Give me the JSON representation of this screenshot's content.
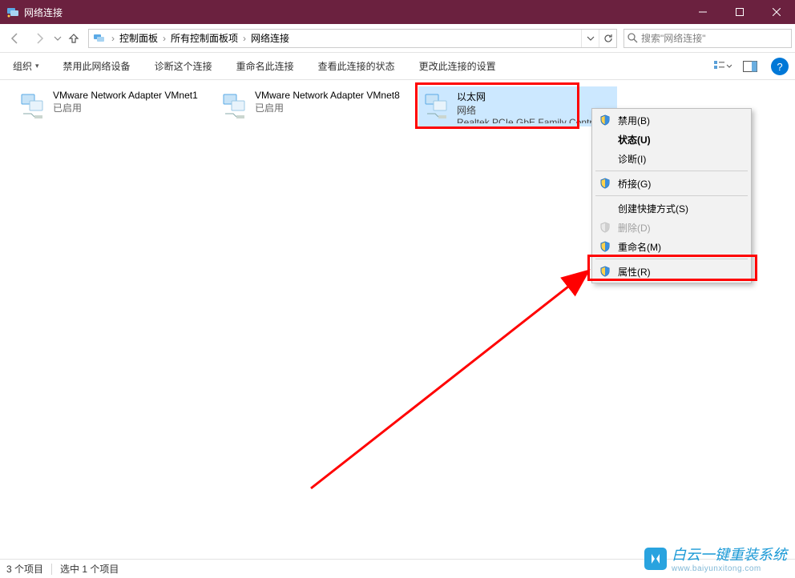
{
  "window": {
    "title": "网络连接"
  },
  "breadcrumbs": {
    "root": "控制面板",
    "mid": "所有控制面板项",
    "leaf": "网络连接"
  },
  "search": {
    "placeholder": "搜索\"网络连接\""
  },
  "commands": {
    "organize": "组织",
    "disable": "禁用此网络设备",
    "diagnose": "诊断这个连接",
    "rename": "重命名此连接",
    "viewstatus": "查看此连接的状态",
    "changeset": "更改此连接的设置"
  },
  "connections": [
    {
      "name": "VMware Network Adapter VMnet1",
      "status": "已启用",
      "device": ""
    },
    {
      "name": "VMware Network Adapter VMnet8",
      "status": "已启用",
      "device": ""
    },
    {
      "name": "以太网",
      "status": "网络",
      "device": "Realtek PCIe GbE Family Controller"
    }
  ],
  "context_menu": {
    "disable": "禁用(B)",
    "status": "状态(U)",
    "diagnose": "诊断(I)",
    "bridge": "桥接(G)",
    "shortcut": "创建快捷方式(S)",
    "delete": "删除(D)",
    "rename": "重命名(M)",
    "properties": "属性(R)"
  },
  "statusbar": {
    "count": "3 个项目",
    "selected": "选中 1 个项目"
  },
  "watermark": {
    "text": "白云一键重装系统",
    "url": "www.baiyunxitong.com"
  }
}
